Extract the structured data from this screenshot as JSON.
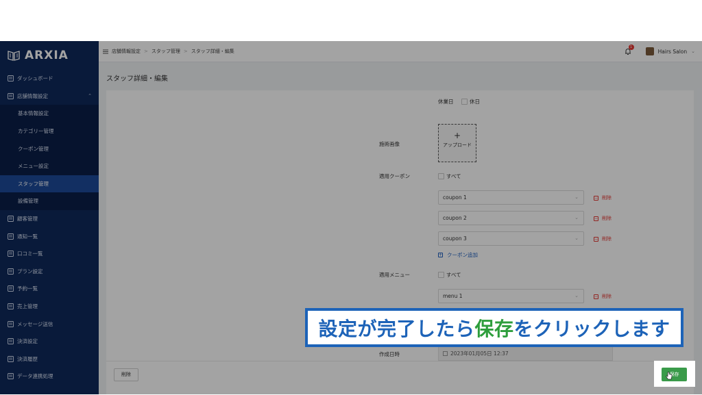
{
  "brand": {
    "name": "ARXIA"
  },
  "header": {
    "breadcrumb": [
      "店舗情報設定",
      "スタッフ管理",
      "スタッフ詳細・編集"
    ],
    "notification_count": "1",
    "user_name": "Hairs Salon"
  },
  "sidebar": {
    "items": [
      {
        "label": "ダッシュボード",
        "icon": "dashboard-icon"
      },
      {
        "label": "店舗情報設定",
        "icon": "store-icon",
        "expanded": true
      },
      {
        "label": "基本情報設定",
        "sub": true
      },
      {
        "label": "カテゴリー管理",
        "sub": true
      },
      {
        "label": "クーポン管理",
        "sub": true
      },
      {
        "label": "メニュー設定",
        "sub": true
      },
      {
        "label": "スタッフ管理",
        "sub": true,
        "active": true
      },
      {
        "label": "設備管理",
        "sub": true
      },
      {
        "label": "顧客管理",
        "icon": "customer-icon"
      },
      {
        "label": "通知一覧",
        "icon": "notice-icon"
      },
      {
        "label": "口コミ一覧",
        "icon": "review-icon"
      },
      {
        "label": "プラン設定",
        "icon": "plan-icon"
      },
      {
        "label": "予約一覧",
        "icon": "reservation-icon"
      },
      {
        "label": "売上管理",
        "icon": "sales-icon"
      },
      {
        "label": "メッセージ送信",
        "icon": "message-icon"
      },
      {
        "label": "決済設定",
        "icon": "payment-icon"
      },
      {
        "label": "決済履歴",
        "icon": "payment-history-icon"
      },
      {
        "label": "データ連携処理",
        "icon": "data-sync-icon"
      }
    ]
  },
  "page": {
    "title": "スタッフ詳細・編集"
  },
  "form": {
    "holiday_label": "休業日",
    "holiday_option": "休日",
    "image_label": "施術画像",
    "upload_label": "アップロード",
    "coupon_label": "適用クーポン",
    "coupon_all": "すべて",
    "coupons": [
      "coupon 1",
      "coupon 2",
      "coupon 3"
    ],
    "delete_label": "削除",
    "add_coupon": "クーポン追加",
    "menu_label": "適用メニュー",
    "menu_all": "すべて",
    "menus": [
      "menu 1"
    ],
    "created_label": "作成日時",
    "created_value": "2023年01月05日 12:37"
  },
  "footer": {
    "delete_button": "削除",
    "save_button": "保存"
  },
  "caption": {
    "before": "設定が完了したら",
    "highlight": "保存",
    "after": "をクリックします"
  },
  "colors": {
    "sidebar": "#0f2a5c",
    "active": "#1d4a9a",
    "save": "#3a9b4a",
    "caption_border": "#1d63b8",
    "caption_highlight": "#2e9e3c",
    "danger": "#e53935"
  }
}
